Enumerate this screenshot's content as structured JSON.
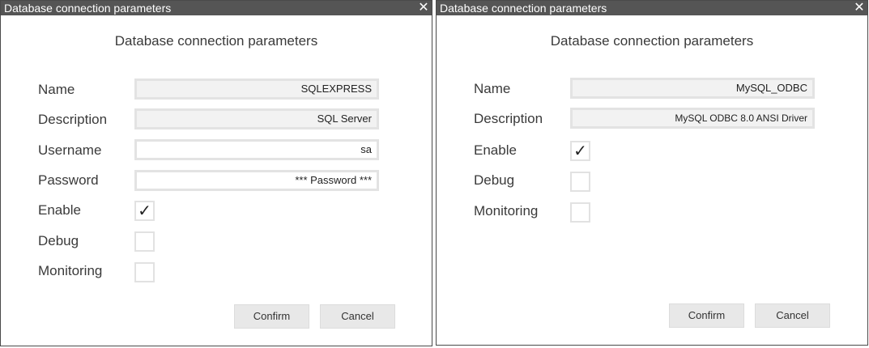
{
  "left_dialog": {
    "window_title": "Database connection parameters",
    "close_glyph": "✕",
    "heading": "Database connection parameters",
    "labels": {
      "name": "Name",
      "description": "Description",
      "username": "Username",
      "password": "Password",
      "enable": "Enable",
      "debug": "Debug",
      "monitoring": "Monitoring"
    },
    "values": {
      "name": "SQLEXPRESS",
      "description": "SQL Server",
      "username": "sa",
      "password": "*** Password ***"
    },
    "checks": {
      "enable": "✓",
      "debug": "",
      "monitoring": ""
    },
    "buttons": {
      "confirm": "Confirm",
      "cancel": "Cancel"
    }
  },
  "right_dialog": {
    "window_title": "Database connection parameters",
    "close_glyph": "✕",
    "heading": "Database connection parameters",
    "labels": {
      "name": "Name",
      "description": "Description",
      "enable": "Enable",
      "debug": "Debug",
      "monitoring": "Monitoring"
    },
    "values": {
      "name": "MySQL_ODBC",
      "description": "MySQL ODBC 8.0 ANSI Driver"
    },
    "checks": {
      "enable": "✓",
      "debug": "",
      "monitoring": ""
    },
    "buttons": {
      "confirm": "Confirm",
      "cancel": "Cancel"
    }
  },
  "icons": [
    "close-icon",
    "checkmark-icon"
  ],
  "colors": {
    "titlebar": "#555555",
    "field_border": "#e3e3e3",
    "button_bg": "#e8e8e8"
  }
}
